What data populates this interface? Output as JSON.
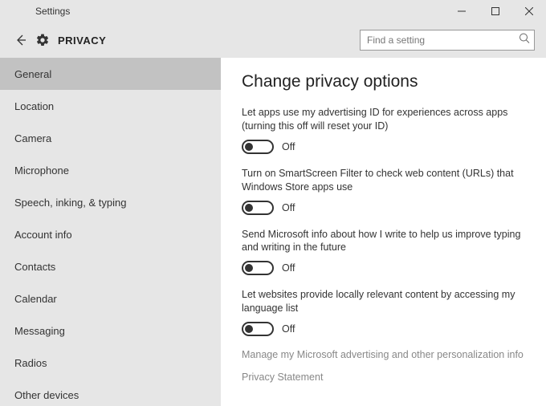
{
  "window": {
    "title": "Settings"
  },
  "header": {
    "page_title": "PRIVACY",
    "search_placeholder": "Find a setting"
  },
  "sidebar": {
    "items": [
      {
        "label": "General",
        "selected": true
      },
      {
        "label": "Location",
        "selected": false
      },
      {
        "label": "Camera",
        "selected": false
      },
      {
        "label": "Microphone",
        "selected": false
      },
      {
        "label": "Speech, inking, & typing",
        "selected": false
      },
      {
        "label": "Account info",
        "selected": false
      },
      {
        "label": "Contacts",
        "selected": false
      },
      {
        "label": "Calendar",
        "selected": false
      },
      {
        "label": "Messaging",
        "selected": false
      },
      {
        "label": "Radios",
        "selected": false
      },
      {
        "label": "Other devices",
        "selected": false
      }
    ]
  },
  "main": {
    "heading": "Change privacy options",
    "settings": [
      {
        "desc": "Let apps use my advertising ID for experiences across apps (turning this off will reset your ID)",
        "state": "Off"
      },
      {
        "desc": "Turn on SmartScreen Filter to check web content (URLs) that Windows Store apps use",
        "state": "Off"
      },
      {
        "desc": "Send Microsoft info about how I write to help us improve typing and writing in the future",
        "state": "Off"
      },
      {
        "desc": "Let websites provide locally relevant content by accessing my language list",
        "state": "Off"
      }
    ],
    "links": [
      "Manage my Microsoft advertising and other personalization info",
      "Privacy Statement"
    ]
  }
}
